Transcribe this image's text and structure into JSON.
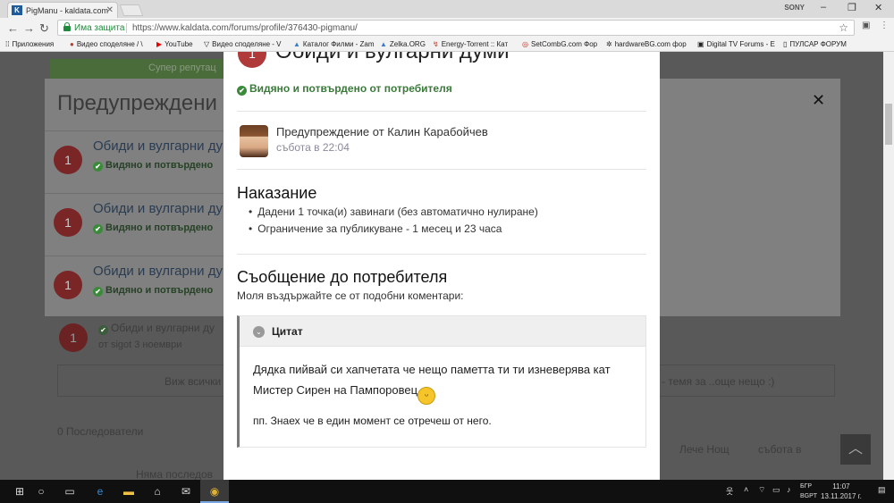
{
  "browser": {
    "tab_title": "PigManu - kaldata.com",
    "tab_favicon": "K",
    "top_right_label": "SONY",
    "window_controls": [
      "–",
      "❐",
      "✕"
    ],
    "secure_label": "Има защита",
    "url": "https://www.kaldata.com/forums/profile/376430-pigmanu/",
    "bookmarks": [
      {
        "label": "Приложения",
        "icon": "apps-icon"
      },
      {
        "label": "Видео споделяне / \\",
        "icon": "video-icon"
      },
      {
        "label": "YouTube",
        "icon": "youtube-icon"
      },
      {
        "label": "Видео споделяне - V",
        "icon": "v-icon"
      },
      {
        "label": "Каталог Филми - Zam",
        "icon": "zamunda-icon"
      },
      {
        "label": "Zelka.ORG",
        "icon": "zelka-icon"
      },
      {
        "label": "Energy-Torrent :: Кат",
        "icon": "energy-icon"
      },
      {
        "label": "SetCombG.com Фор",
        "icon": "setcombg-icon"
      },
      {
        "label": "hardwareBG.com фор",
        "icon": "hardwarebg-icon"
      },
      {
        "label": "Digital TV Forums - E",
        "icon": "digitaltv-icon"
      },
      {
        "label": "ПУЛСАР ФОРУМ",
        "icon": "pulsar-icon"
      }
    ]
  },
  "background": {
    "heading": "Предупреждени",
    "super_badge": "Супер репутац",
    "rows": [
      {
        "number": "1",
        "title": "Обиди и вулгарни ду",
        "status": "Видяно и потвърдено"
      },
      {
        "number": "1",
        "title": "Обиди и вулгарни ду",
        "status": "Видяно и потвърдено"
      },
      {
        "number": "1",
        "title": "Обиди и вулгарни ду",
        "status": "Видяно и потвърдено"
      }
    ],
    "behind_item": {
      "number": "1",
      "title": "Обиди и вулгарни ду",
      "meta": "от sigot 3 ноември"
    },
    "view_all": "Виж всички",
    "topic_hint": "- темя за ..още нещо :)",
    "followers": "0 Последователи",
    "no_followers": "Няма последов",
    "last_visitor": "Лече Нощ",
    "last_visitor_time": "събота в"
  },
  "modal": {
    "number": "1",
    "title": "Обиди и вулгарни думи",
    "seen_status": "Видяно и потвърдено от потребителя",
    "warning_by": "Предупреждение от Калин Карабойчев",
    "warning_time": "събота в 22:04",
    "punishment_heading": "Наказание",
    "punishments": [
      "Дадени 1 точка(и) завинаги (без автоматично нулиране)",
      "Ограничение за публикуване - 1 месец и 23 часа"
    ],
    "message_heading": "Съобщение до потребителя",
    "message_text": "Моля въздържайте се от подобни коментари:",
    "quote_label": "Цитат",
    "quote_line1": "Дядка пийвай си хапчетата че нещо паметта ти ти изневерява кат Мистер Сирен на Пампоровец",
    "quote_line2": "пп. Знаех че в един момент се отречеш от него."
  },
  "taskbar": {
    "language_top": "БГР",
    "language_bottom": "BGPT",
    "time": "11:07",
    "date": "13.11.2017 г."
  }
}
